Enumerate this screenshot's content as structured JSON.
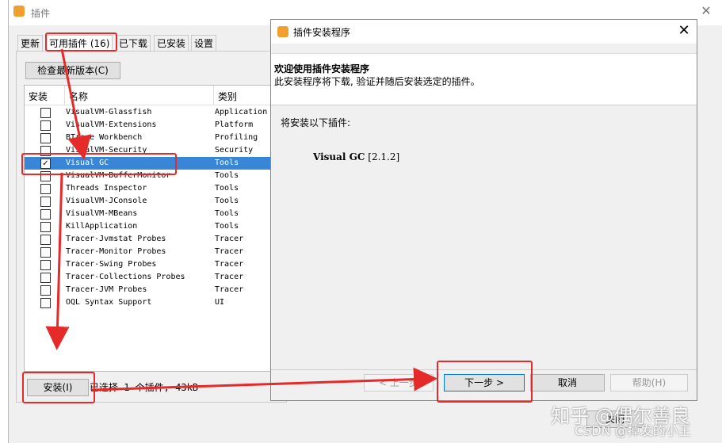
{
  "bg_window": {
    "title": "插件",
    "tabs": [
      "更新",
      "可用插件 (16)",
      "已下载",
      "已安装",
      "设置"
    ],
    "check_button": "检查最新版本(C)",
    "table_headers": {
      "install": "安装",
      "name": "名称",
      "category": "类别"
    },
    "rows": [
      {
        "name": "VisualVM-Glassfish",
        "category": "Application",
        "checked": false
      },
      {
        "name": "VisualVM-Extensions",
        "category": "Platform",
        "checked": false
      },
      {
        "name": "BTrace Workbench",
        "category": "Profiling",
        "checked": false
      },
      {
        "name": "VisualVM-Security",
        "category": "Security",
        "checked": false
      },
      {
        "name": "Visual GC",
        "category": "Tools",
        "checked": true
      },
      {
        "name": "VisualVM-BufferMonitor",
        "category": "Tools",
        "checked": false
      },
      {
        "name": "Threads Inspector",
        "category": "Tools",
        "checked": false
      },
      {
        "name": "VisualVM-JConsole",
        "category": "Tools",
        "checked": false
      },
      {
        "name": "VisualVM-MBeans",
        "category": "Tools",
        "checked": false
      },
      {
        "name": "KillApplication",
        "category": "Tools",
        "checked": false
      },
      {
        "name": "Tracer-Jvmstat Probes",
        "category": "Tracer",
        "checked": false
      },
      {
        "name": "Tracer-Monitor Probes",
        "category": "Tracer",
        "checked": false
      },
      {
        "name": "Tracer-Swing Probes",
        "category": "Tracer",
        "checked": false
      },
      {
        "name": "Tracer-Collections Probes",
        "category": "Tracer",
        "checked": false
      },
      {
        "name": "Tracer-JVM Probes",
        "category": "Tracer",
        "checked": false
      },
      {
        "name": "OQL Syntax Support",
        "category": "UI",
        "checked": false
      }
    ],
    "install_button": "安装(I)",
    "status": "已选择 1 个插件, 43kB"
  },
  "dialog": {
    "title": "插件安装程序",
    "header_title": "欢迎使用插件安装程序",
    "header_subtitle": "此安装程序将下载, 验证并随后安装选定的插件。",
    "body_text": "将安装以下插件:",
    "plugin_name": "Visual GC",
    "plugin_version": "[2.1.2]",
    "buttons": {
      "back": "< 上一步",
      "next": "下一步 >",
      "cancel": "取消",
      "help": "帮助(H)"
    },
    "bottom_right_button": "关闭"
  },
  "watermark": {
    "line1": "知乎 @偶尔善良",
    "line2": "CSDN @掉发的小王"
  },
  "colors": {
    "selection": "#3a86d6",
    "annotation_red": "#e52a2a",
    "accent": "#0078d7"
  }
}
